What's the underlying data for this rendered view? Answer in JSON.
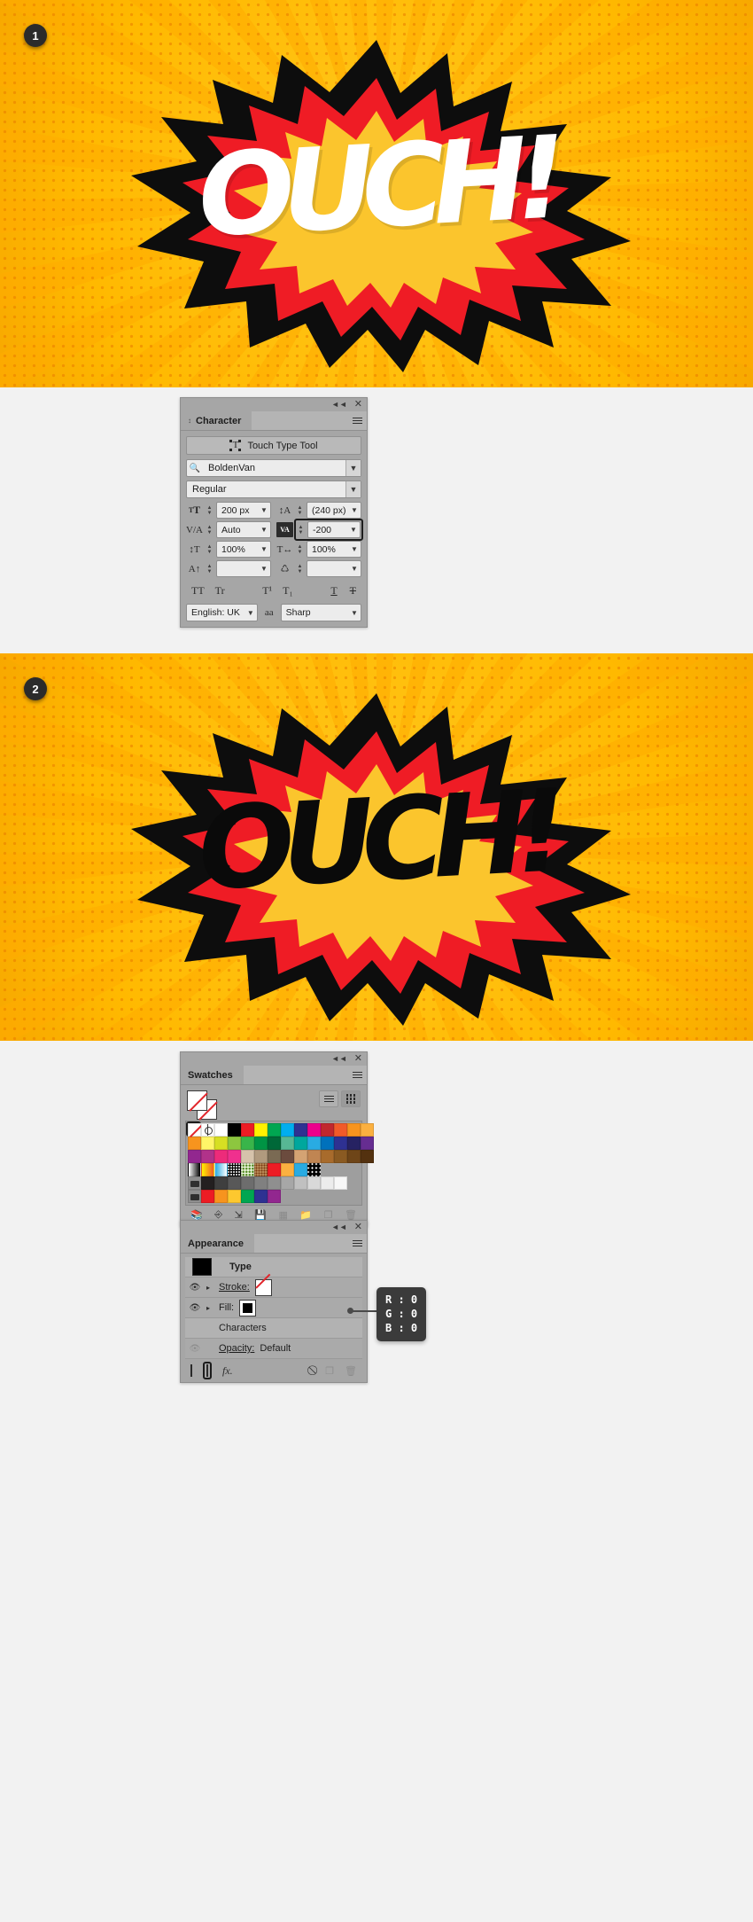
{
  "steps": [
    {
      "number": "1"
    },
    {
      "number": "2"
    }
  ],
  "artwork": {
    "word": "OUCH!",
    "step1_color": "#ffffff",
    "step2_color": "#0a0a0a",
    "burst_red": "#ef1c25",
    "burst_yellow": "#fbc52d",
    "background_yellow": "#ffb900",
    "dot_color": "#e87a00"
  },
  "character_panel": {
    "tab": "Character",
    "touch_type_tool": "Touch Type Tool",
    "font_family": "BoldenVan",
    "font_style": "Regular",
    "font_size": "200 px",
    "leading": "(240 px)",
    "kerning": "Auto",
    "tracking": "-200",
    "vertical_scale": "100%",
    "horizontal_scale": "100%",
    "baseline_shift": "",
    "character_rotation": "",
    "style_buttons": [
      "TT",
      "Tr",
      "T¹",
      "T₁",
      "T",
      "T"
    ],
    "language": "English: UK",
    "anti_alias": "Sharp",
    "aa_icon_label": "aa"
  },
  "swatches_panel": {
    "tab": "Swatches",
    "view_list": "list-view",
    "view_grid": "grid-view",
    "rows": [
      [
        "none",
        "reg",
        "#ffffff",
        "#000000",
        "#ed1c24",
        "#fff200",
        "#00a651",
        "#00aeef",
        "#2e3192",
        "#ec008c",
        "#c1272d",
        "#f15a29",
        "#f7941e",
        "#fbb040"
      ],
      [
        "#f7941e",
        "#fff568",
        "#d7df23",
        "#8dc63f",
        "#39b54a",
        "#009444",
        "#006838",
        "#57b894",
        "#00a79d",
        "#29abe2",
        "#0071bc",
        "#2e3192",
        "#262262",
        "#662d91"
      ],
      [
        "#92278f",
        "#b1328a",
        "#ed2b7a",
        "#f0308e",
        "#d6c3ab",
        "#b09a7e",
        "#7a6a53",
        "#6b4b3e",
        "#d4a373",
        "#c08552",
        "#a86b2c",
        "#8a5a22",
        "#6e4518",
        "#53310f"
      ],
      [
        "gradient-bw",
        "gradient-orange",
        "gradient-blue",
        "pattern-dots",
        "pattern-leaves",
        "pattern-confetti",
        "#ed1c24",
        "#fbb040",
        "#29abe2",
        "pattern-polka"
      ],
      [
        "folder",
        "#231f20",
        "#3f3f3f",
        "#585858",
        "#6d6d6d",
        "#808080",
        "#8f8f8f",
        "#a7a7a7",
        "#c0c0c0",
        "#d9d9d9",
        "#ececec",
        "#f7f7f7"
      ],
      [
        "folder",
        "#ed1c24",
        "#f7941e",
        "#fdc82f",
        "#00a651",
        "#2e3192",
        "#92278f"
      ]
    ],
    "toolbar_icons": [
      "swatch-libraries-icon",
      "link-icon",
      "new-color-group-icon",
      "save-swatch-icon",
      "edit-swatch-icon",
      "new-group-icon",
      "new-swatch-icon",
      "delete-swatch-icon"
    ]
  },
  "appearance_panel": {
    "tab": "Appearance",
    "object_type": "Type",
    "stroke_label": "Stroke:",
    "fill_label": "Fill:",
    "characters_label": "Characters",
    "opacity_label": "Opacity:",
    "opacity_value": "Default",
    "fx_label": "fx.",
    "toolbar_icons": [
      "add-new-stroke-icon",
      "add-new-fill-icon",
      "add-fx-icon",
      "clear-appearance-icon",
      "duplicate-item-icon",
      "delete-item-icon"
    ]
  },
  "callout": {
    "r": "R : 0",
    "g": "G : 0",
    "b": "B : 0"
  }
}
